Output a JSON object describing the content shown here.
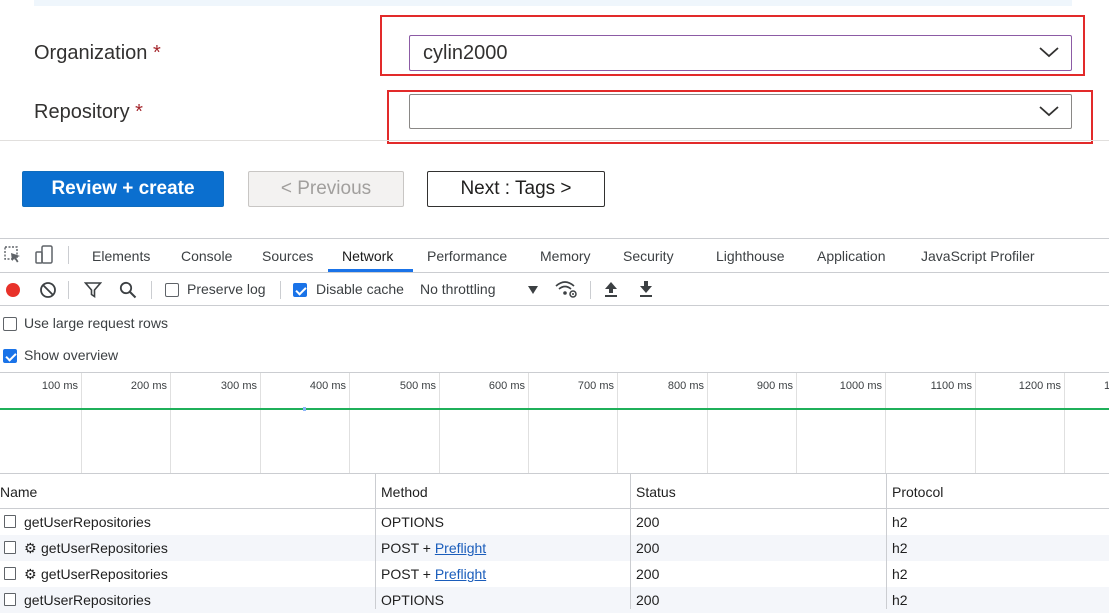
{
  "form": {
    "organization_label": "Organization",
    "organization_required": "*",
    "organization_value": "cylin2000",
    "repository_label": "Repository",
    "repository_required": "*",
    "repository_value": ""
  },
  "buttons": {
    "review_create": "Review + create",
    "previous": "< Previous",
    "next": "Next : Tags >"
  },
  "devtools": {
    "tabs": [
      "Elements",
      "Console",
      "Sources",
      "Network",
      "Performance",
      "Memory",
      "Security",
      "Lighthouse",
      "Application",
      "JavaScript Profiler"
    ],
    "active_tab": "Network",
    "toolbar": {
      "preserve_log": "Preserve log",
      "preserve_log_checked": false,
      "disable_cache": "Disable cache",
      "disable_cache_checked": true,
      "throttling": "No throttling"
    },
    "options": {
      "large_rows": "Use large request rows",
      "large_rows_checked": false,
      "show_overview": "Show overview",
      "show_overview_checked": true
    },
    "ruler_ticks": [
      "100 ms",
      "200 ms",
      "300 ms",
      "400 ms",
      "500 ms",
      "600 ms",
      "700 ms",
      "800 ms",
      "900 ms",
      "1000 ms",
      "1100 ms",
      "1200 ms",
      "1"
    ],
    "columns": [
      "Name",
      "Method",
      "Status",
      "Protocol"
    ],
    "rows": [
      {
        "name": "getUserRepositories",
        "gear": false,
        "method": "OPTIONS",
        "method_link": "",
        "status": "200",
        "protocol": "h2"
      },
      {
        "name": "getUserRepositories",
        "gear": true,
        "method": "POST + ",
        "method_link": "Preflight",
        "status": "200",
        "protocol": "h2"
      },
      {
        "name": "getUserRepositories",
        "gear": true,
        "method": "POST + ",
        "method_link": "Preflight",
        "status": "200",
        "protocol": "h2"
      },
      {
        "name": "getUserRepositories",
        "gear": false,
        "method": "OPTIONS",
        "method_link": "",
        "status": "200",
        "protocol": "h2"
      }
    ],
    "gear_glyph": "⚙"
  }
}
